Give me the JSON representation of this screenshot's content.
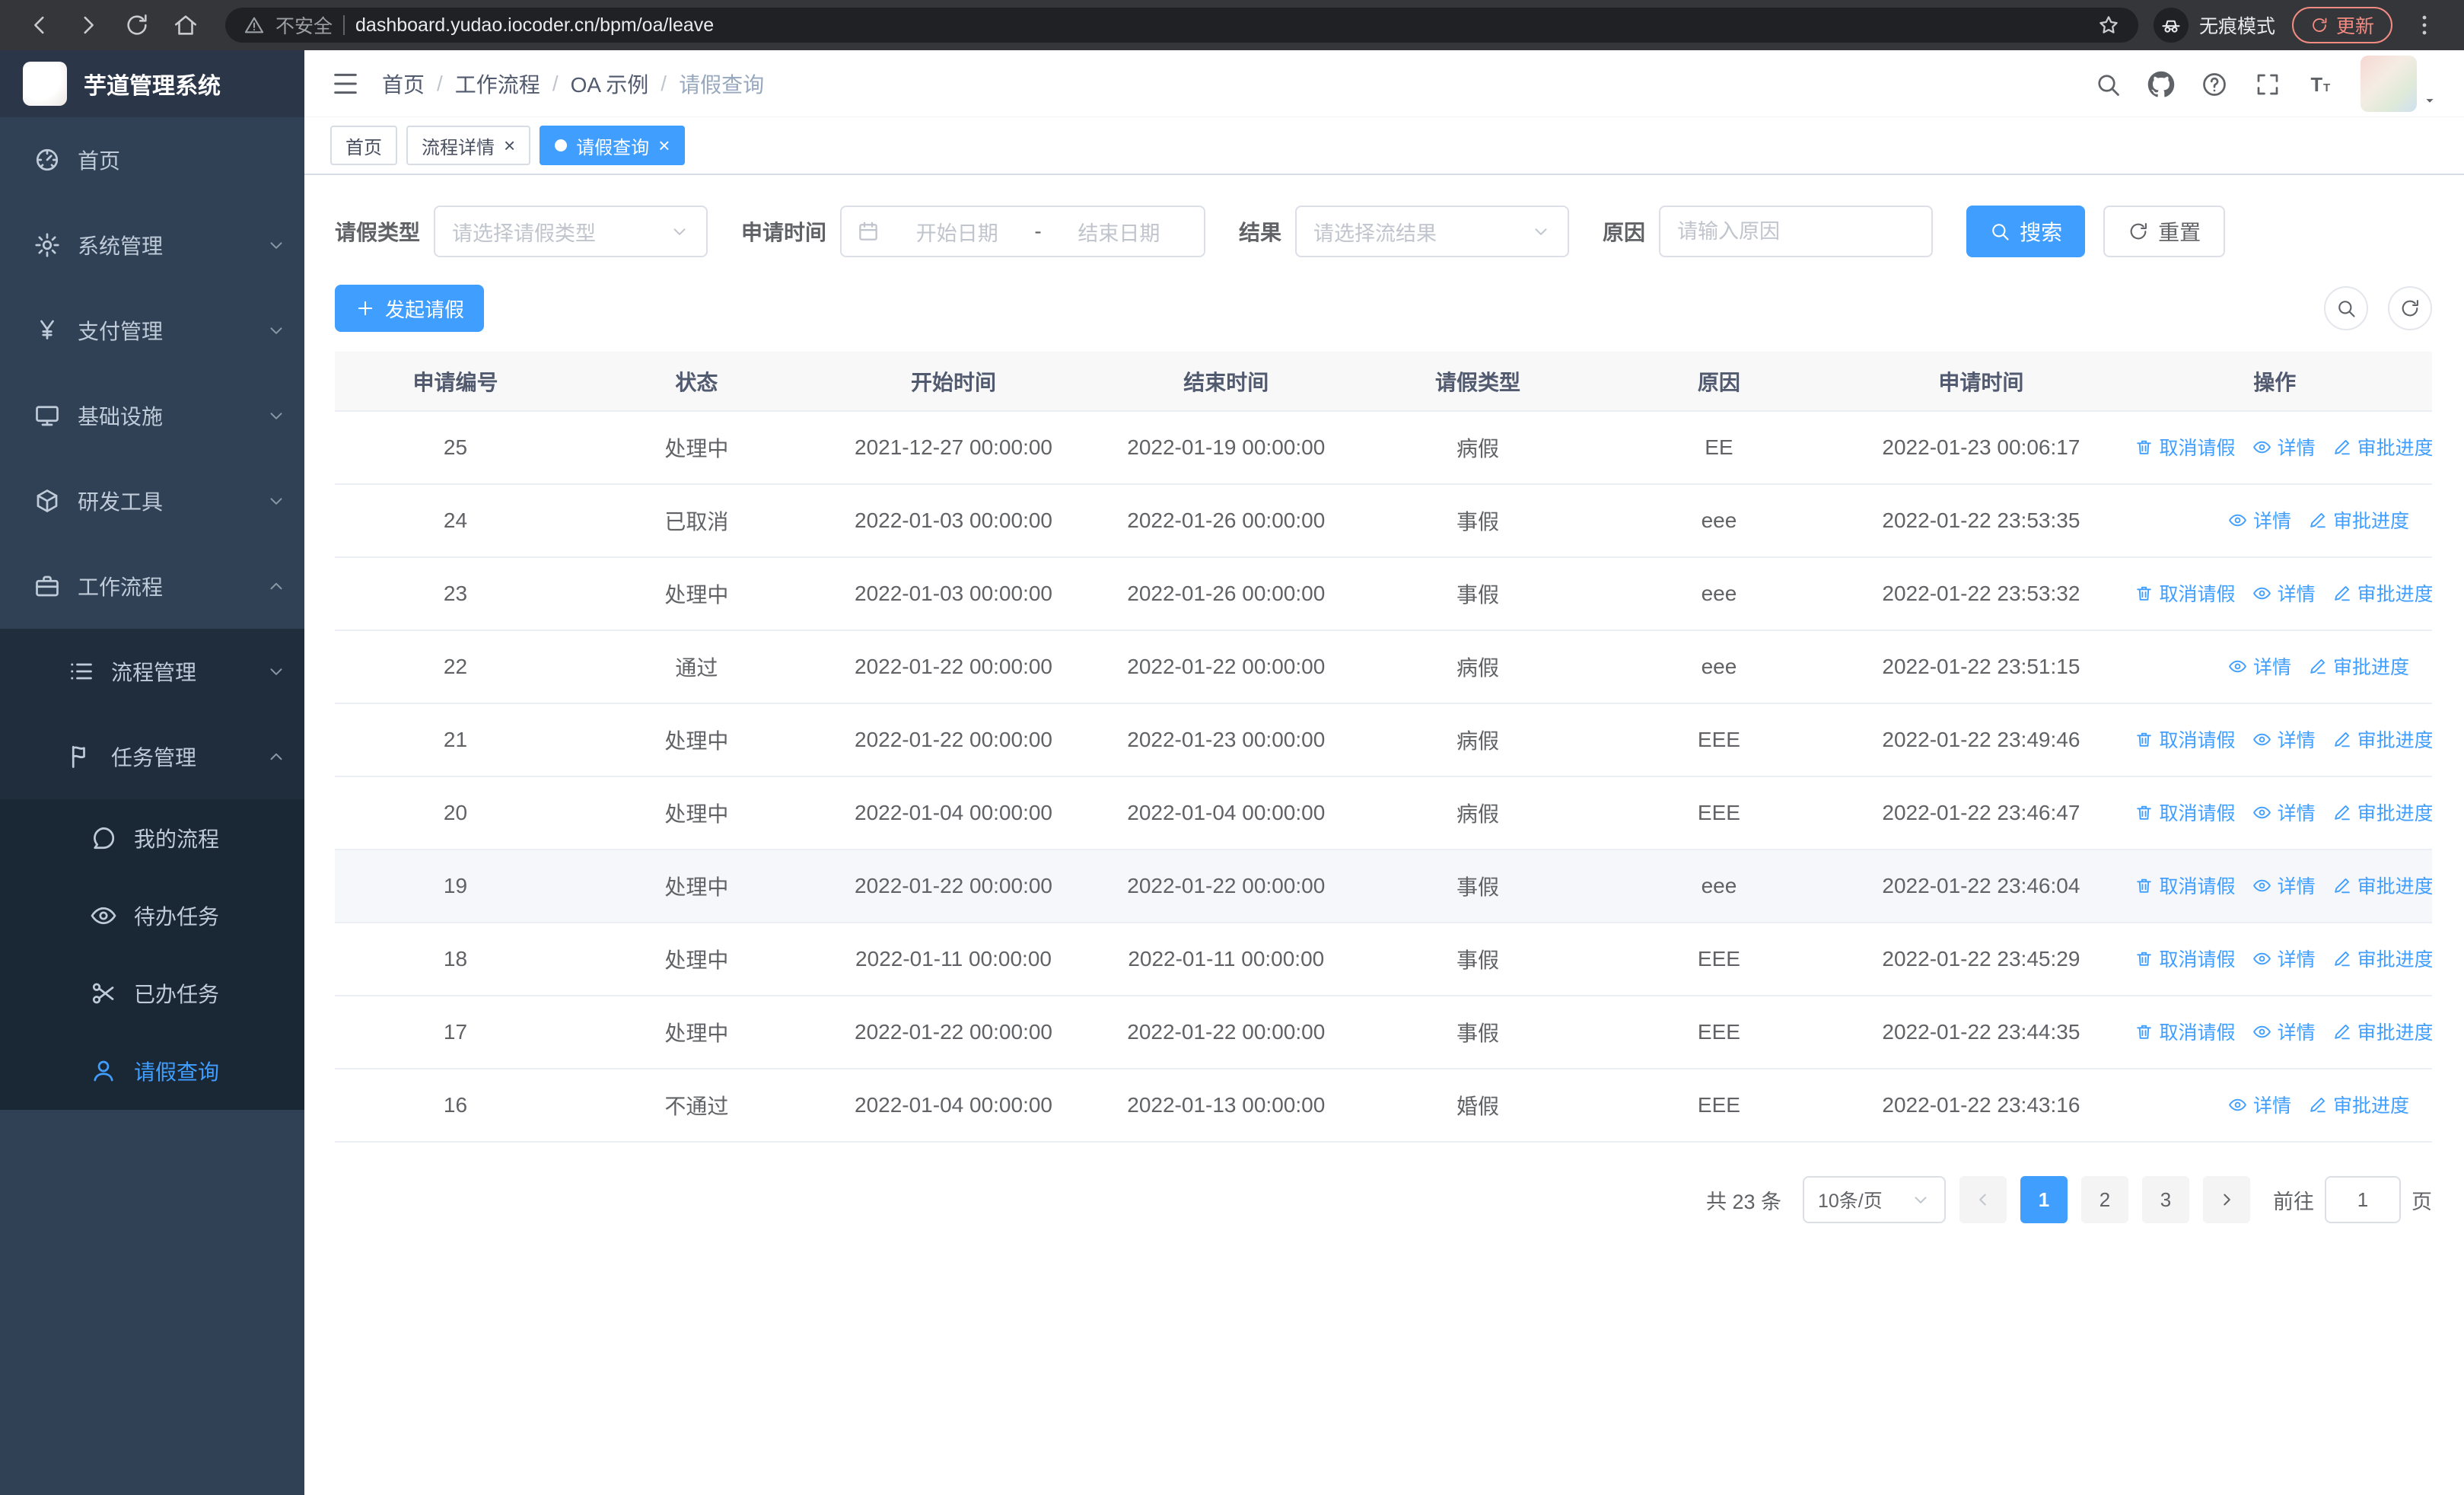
{
  "browser": {
    "security_label": "不安全",
    "url": "dashboard.yudao.iocoder.cn/bpm/oa/leave",
    "incognito_label": "无痕模式",
    "update_label": "更新"
  },
  "sidebar": {
    "logo_title": "芋道管理系统",
    "items": [
      {
        "label": "首页"
      },
      {
        "label": "系统管理"
      },
      {
        "label": "支付管理"
      },
      {
        "label": "基础设施"
      },
      {
        "label": "研发工具"
      },
      {
        "label": "工作流程"
      }
    ],
    "workflow_children": [
      {
        "label": "流程管理"
      },
      {
        "label": "任务管理"
      }
    ],
    "task_children": [
      {
        "label": "我的流程"
      },
      {
        "label": "待办任务"
      },
      {
        "label": "已办任务"
      },
      {
        "label": "请假查询"
      }
    ]
  },
  "header": {
    "breadcrumb": [
      "首页",
      "工作流程",
      "OA 示例",
      "请假查询"
    ]
  },
  "tabs": [
    {
      "label": "首页"
    },
    {
      "label": "流程详情"
    },
    {
      "label": "请假查询"
    }
  ],
  "filters": {
    "leave_type_label": "请假类型",
    "leave_type_placeholder": "请选择请假类型",
    "apply_time_label": "申请时间",
    "start_placeholder": "开始日期",
    "separator": "-",
    "end_placeholder": "结束日期",
    "result_label": "结果",
    "result_placeholder": "请选择流结果",
    "reason_label": "原因",
    "reason_placeholder": "请输入原因",
    "search_label": "搜索",
    "reset_label": "重置"
  },
  "toolbar": {
    "create_label": "发起请假"
  },
  "table": {
    "columns": [
      "申请编号",
      "状态",
      "开始时间",
      "结束时间",
      "请假类型",
      "原因",
      "申请时间",
      "操作"
    ],
    "actions": {
      "cancel": "取消请假",
      "detail": "详情",
      "progress": "审批进度"
    },
    "rows": [
      {
        "id": "25",
        "status": "处理中",
        "start": "2021-12-27 00:00:00",
        "end": "2022-01-19 00:00:00",
        "type": "病假",
        "reason": "EE",
        "apply_time": "2022-01-23 00:06:17",
        "cancellable": true
      },
      {
        "id": "24",
        "status": "已取消",
        "start": "2022-01-03 00:00:00",
        "end": "2022-01-26 00:00:00",
        "type": "事假",
        "reason": "eee",
        "apply_time": "2022-01-22 23:53:35",
        "cancellable": false
      },
      {
        "id": "23",
        "status": "处理中",
        "start": "2022-01-03 00:00:00",
        "end": "2022-01-26 00:00:00",
        "type": "事假",
        "reason": "eee",
        "apply_time": "2022-01-22 23:53:32",
        "cancellable": true
      },
      {
        "id": "22",
        "status": "通过",
        "start": "2022-01-22 00:00:00",
        "end": "2022-01-22 00:00:00",
        "type": "病假",
        "reason": "eee",
        "apply_time": "2022-01-22 23:51:15",
        "cancellable": false
      },
      {
        "id": "21",
        "status": "处理中",
        "start": "2022-01-22 00:00:00",
        "end": "2022-01-23 00:00:00",
        "type": "病假",
        "reason": "EEE",
        "apply_time": "2022-01-22 23:49:46",
        "cancellable": true
      },
      {
        "id": "20",
        "status": "处理中",
        "start": "2022-01-04 00:00:00",
        "end": "2022-01-04 00:00:00",
        "type": "病假",
        "reason": "EEE",
        "apply_time": "2022-01-22 23:46:47",
        "cancellable": true
      },
      {
        "id": "19",
        "status": "处理中",
        "start": "2022-01-22 00:00:00",
        "end": "2022-01-22 00:00:00",
        "type": "事假",
        "reason": "eee",
        "apply_time": "2022-01-22 23:46:04",
        "cancellable": true,
        "highlight": true
      },
      {
        "id": "18",
        "status": "处理中",
        "start": "2022-01-11 00:00:00",
        "end": "2022-01-11 00:00:00",
        "type": "事假",
        "reason": "EEE",
        "apply_time": "2022-01-22 23:45:29",
        "cancellable": true
      },
      {
        "id": "17",
        "status": "处理中",
        "start": "2022-01-22 00:00:00",
        "end": "2022-01-22 00:00:00",
        "type": "事假",
        "reason": "EEE",
        "apply_time": "2022-01-22 23:44:35",
        "cancellable": true
      },
      {
        "id": "16",
        "status": "不通过",
        "start": "2022-01-04 00:00:00",
        "end": "2022-01-13 00:00:00",
        "type": "婚假",
        "reason": "EEE",
        "apply_time": "2022-01-22 23:43:16",
        "cancellable": false
      }
    ]
  },
  "pagination": {
    "total": "共 23 条",
    "page_size": "10条/页",
    "pages": [
      "1",
      "2",
      "3"
    ],
    "active_page": "1",
    "goto_label": "前往",
    "goto_value": "1",
    "unit_label": "页"
  },
  "icons": {
    "search-icon": "magnifier",
    "github-icon": "octocat-mark",
    "help-icon": "question-circle",
    "fullscreen-icon": "corner-brackets",
    "font-size-icon": "double-T",
    "cancel-leave-icon": "trash",
    "detail-icon": "eye",
    "approval-progress-icon": "pen",
    "refresh-icon": "circular-arrow",
    "calendar-icon": "calendar",
    "incognito-icon": "hat-and-glasses"
  }
}
